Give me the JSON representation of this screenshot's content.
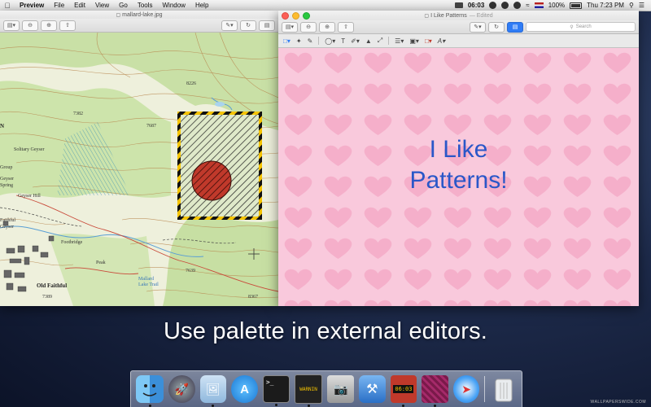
{
  "menubar": {
    "app": "Preview",
    "items": [
      "File",
      "Edit",
      "View",
      "Go",
      "Tools",
      "Window",
      "Help"
    ],
    "timer": "06:03",
    "battery": "100%",
    "clock": "Thu 7:23 PM"
  },
  "map_window": {
    "title": "mallard-lake.jpg",
    "labels": {
      "elev1": "8226",
      "elev2": "7382",
      "elev3": "7687",
      "elev4": "7639",
      "elev5": "7389",
      "elev6": "8367",
      "solitary": "Solitary Geyser",
      "group": "Group",
      "geyser_spring": "Geyser Spring",
      "geyser_hill": "Geyser Hill",
      "faithful": "Faithful Geyser",
      "footbridge": "Footbridge",
      "old_faithful": "Old Faithful",
      "peak": "Peak",
      "mallard": "Mallard Lake Trail",
      "letter_n": "N"
    },
    "colors": {
      "hatch": "#222222",
      "circle": "#c0392b",
      "stripe": "#f5c400"
    }
  },
  "pattern_window": {
    "title": "I Like Patterns",
    "edited": "— Edited",
    "search_placeholder": "Search",
    "heading_line1": "I Like",
    "heading_line2": "Patterns!",
    "colors": {
      "bg": "#f9c9dc",
      "heart": "#f4a7c4",
      "text": "#2a57c8"
    }
  },
  "caption": "Use palette in external editors.",
  "dock": {
    "items": [
      {
        "name": "finder-icon",
        "label": ""
      },
      {
        "name": "launchpad-icon",
        "label": ""
      },
      {
        "name": "preview-app-icon",
        "label": ""
      },
      {
        "name": "app-store-icon",
        "label": ""
      },
      {
        "name": "terminal-icon",
        "label": ">_"
      },
      {
        "name": "console-icon",
        "label": "WARNIN"
      },
      {
        "name": "image-capture-icon",
        "label": ""
      },
      {
        "name": "xcode-icon",
        "label": ""
      },
      {
        "name": "timer-app-icon",
        "label": "06:03"
      },
      {
        "name": "palette-app-icon",
        "label": ""
      },
      {
        "name": "safari-icon",
        "label": ""
      },
      {
        "name": "trash-icon",
        "label": ""
      }
    ]
  },
  "watermark": "WALLPAPERSWIDE.COM"
}
